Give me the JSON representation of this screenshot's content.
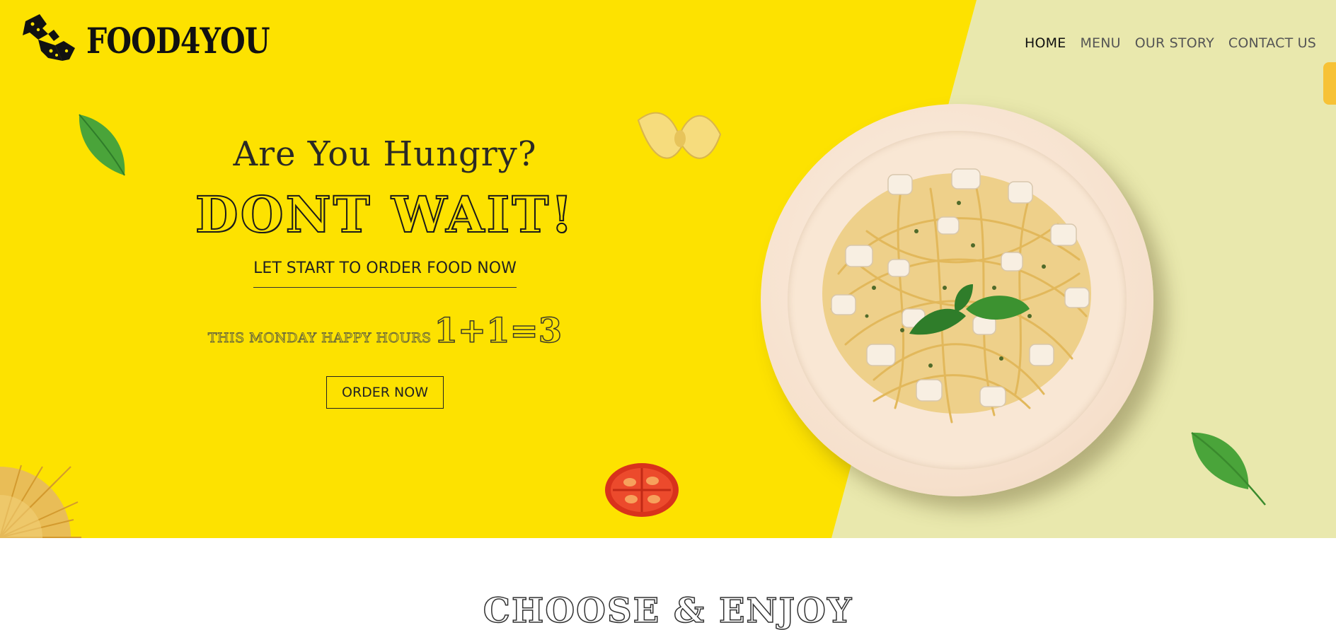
{
  "brand": {
    "name": "FOOD4YOU",
    "logo_icon": "bowtie-pasta-logo-icon"
  },
  "nav": {
    "items": [
      {
        "label": "HOME",
        "active": true
      },
      {
        "label": "MENU",
        "active": false
      },
      {
        "label": "OUR STORY",
        "active": false
      },
      {
        "label": "CONTACT US",
        "active": false
      }
    ]
  },
  "hero": {
    "question": "Are You Hungry?",
    "headline": "DONT WAIT!",
    "subheadline": "LET START TO ORDER FOOD NOW",
    "promo_text": "THIS MONDAY HAPPY HOURS",
    "promo_formula": "1+1=3",
    "cta_label": "ORDER NOW"
  },
  "section": {
    "title": "CHOOSE & ENJOY"
  },
  "colors": {
    "hero_yellow": "#fde200",
    "hero_pale": "#e9e8ad",
    "side_tab": "#f7c236",
    "text_dark": "#222222"
  }
}
